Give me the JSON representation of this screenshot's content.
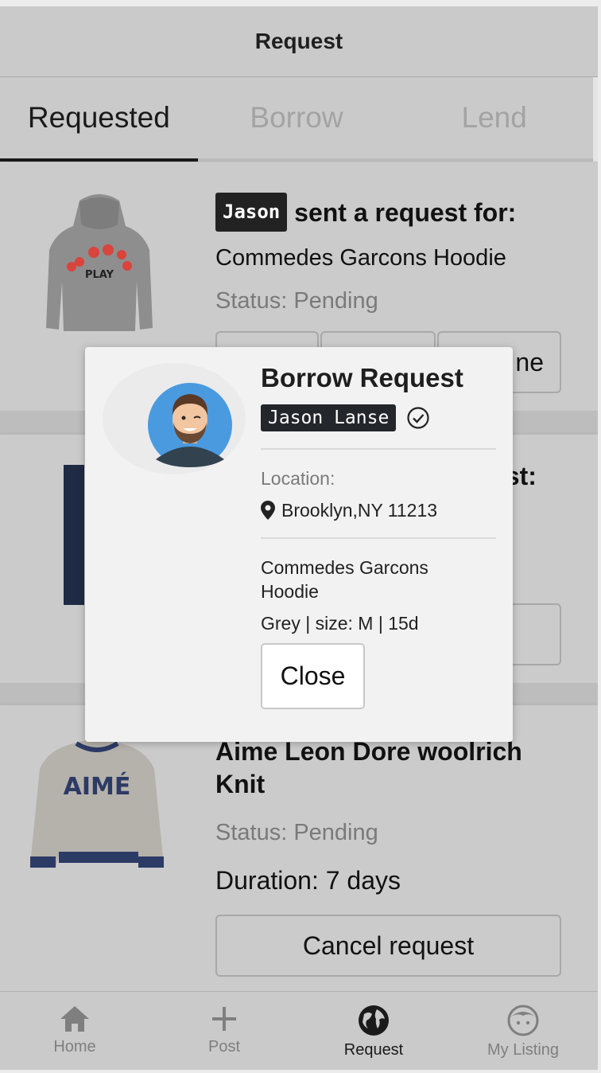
{
  "header": {
    "title": "Request"
  },
  "tabs": [
    {
      "label": "Requested",
      "active": true
    },
    {
      "label": "Borrow",
      "active": false
    },
    {
      "label": "Lend",
      "active": false
    }
  ],
  "cards": [
    {
      "user": "Jason",
      "title_suffix": "sent a request for:",
      "item": "Commedes Garcons Hoodie",
      "status": "Status: Pending",
      "button_tail": "ne"
    },
    {
      "title_tail": "est:"
    },
    {
      "title": "Aime Leon Dore woolrich Knit",
      "status": "Status: Pending",
      "duration": "Duration: 7 days",
      "button": "Cancel request",
      "image_text": "AIMÉ"
    }
  ],
  "hoodie_print": "PLAY",
  "modal": {
    "title": "Borrow Request",
    "user": "Jason Lanse",
    "location_label": "Location:",
    "location": "Brooklyn,NY 11213",
    "item_line1": "Commedes Garcons",
    "item_line2": "Hoodie",
    "details": "Grey | size: M | 15d",
    "close_label": "Close"
  },
  "bottom_nav": [
    {
      "label": "Home",
      "icon": "home-icon",
      "active": false
    },
    {
      "label": "Post",
      "icon": "plus-icon",
      "active": false
    },
    {
      "label": "Request",
      "icon": "globe-icon",
      "active": true
    },
    {
      "label": "My Listing",
      "icon": "face-icon",
      "active": false
    }
  ],
  "colors": {
    "accent": "#1a1a1a",
    "muted": "#7f7f7f",
    "chip": "#23262b",
    "avatar_bg": "#4a9ae0"
  }
}
